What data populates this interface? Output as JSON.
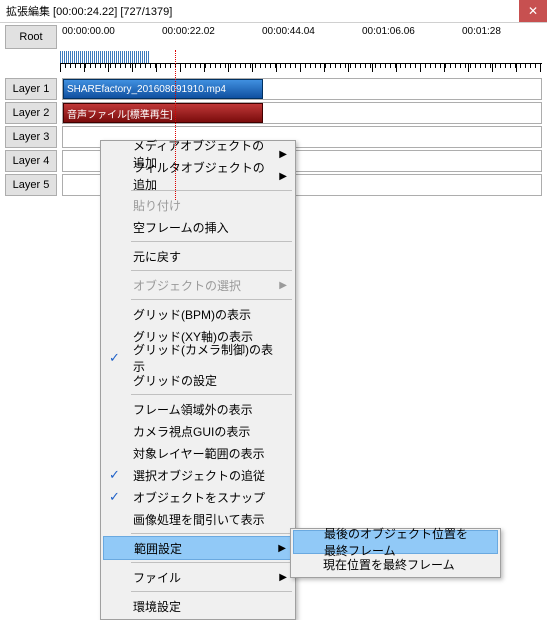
{
  "title": "拡張編集 [00:00:24.22] [727/1379]",
  "close": "✕",
  "root_label": "Root",
  "ruler": {
    "t0": "00:00:00.00",
    "t1": "00:00:22.02",
    "t2": "00:00:44.04",
    "t3": "00:01:06.06",
    "t4": "00:01:28"
  },
  "layers": {
    "l1": "Layer 1",
    "l2": "Layer 2",
    "l3": "Layer 3",
    "l4": "Layer 4",
    "l5": "Layer 5"
  },
  "clips": {
    "video": "SHAREfactory_201608091910.mp4",
    "audio": "音声ファイル[標準再生]"
  },
  "menu": {
    "add_media": "メディアオブジェクトの追加",
    "add_filter": "フィルタオブジェクトの追加",
    "paste": "貼り付け",
    "insert_blank": "空フレームの挿入",
    "undo": "元に戻す",
    "select_obj": "オブジェクトの選択",
    "grid_bpm": "グリッド(BPM)の表示",
    "grid_xy": "グリッド(XY軸)の表示",
    "grid_camera": "グリッド(カメラ制御)の表示",
    "grid_settings": "グリッドの設定",
    "show_outside": "フレーム領域外の表示",
    "show_camera_gui": "カメラ視点GUIの表示",
    "show_target_layer": "対象レイヤー範囲の表示",
    "follow_selected": "選択オブジェクトの追従",
    "snap_obj": "オブジェクトをスナップ",
    "thin_image": "画像処理を間引いて表示",
    "range": "範囲設定",
    "file": "ファイル",
    "env": "環境設定"
  },
  "submenu": {
    "last_obj": "最後のオブジェクト位置を最終フレーム",
    "current": "現在位置を最終フレーム"
  }
}
